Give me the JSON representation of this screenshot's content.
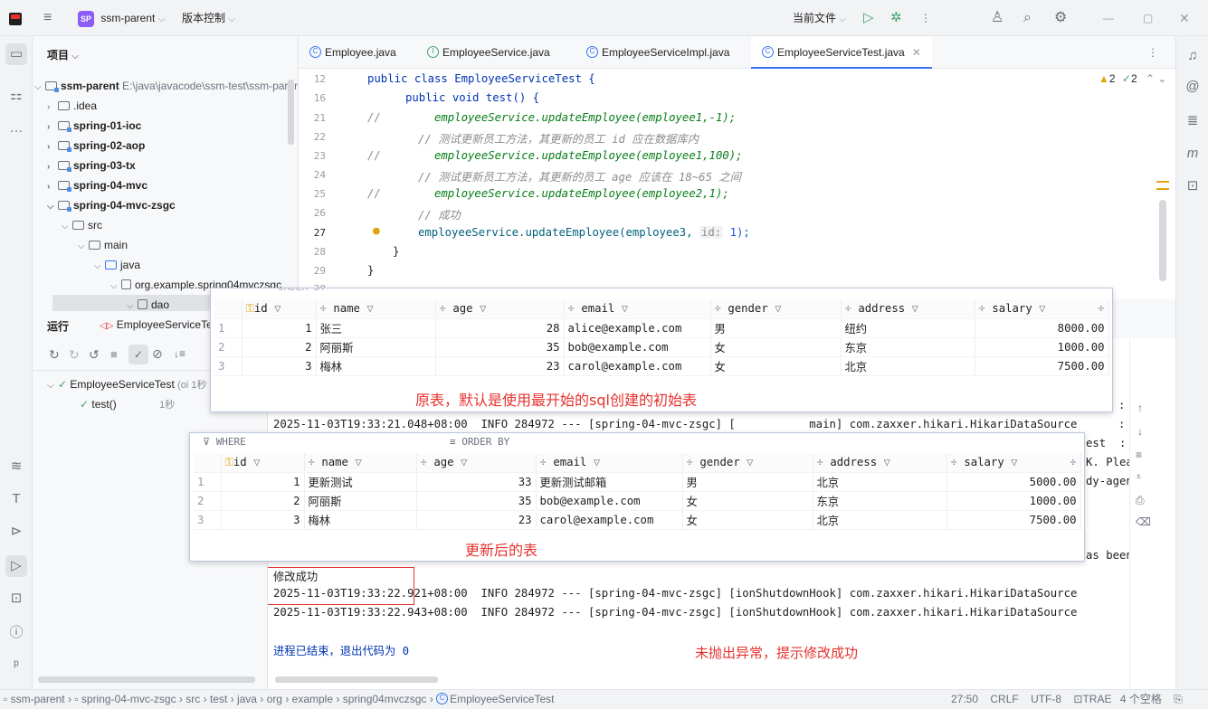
{
  "titlebar": {
    "project": "ssm-parent",
    "project_badge": "SP",
    "vcs": "版本控制",
    "current_file": "当前文件"
  },
  "project_panel": {
    "title": "项目",
    "items": [
      {
        "label": "ssm-parent",
        "path": "E:\\java\\javacode\\ssm-test\\ssm-parent"
      },
      {
        "label": ".idea"
      },
      {
        "label": "spring-01-ioc"
      },
      {
        "label": "spring-02-aop"
      },
      {
        "label": "spring-03-tx"
      },
      {
        "label": "spring-04-mvc"
      },
      {
        "label": "spring-04-mvc-zsgc"
      },
      {
        "label": "src"
      },
      {
        "label": "main"
      },
      {
        "label": "java"
      },
      {
        "label": "org.example.spring04mvczsgc"
      },
      {
        "label": "dao"
      }
    ]
  },
  "tabs": [
    {
      "label": "Employee.java"
    },
    {
      "label": "EmployeeService.java"
    },
    {
      "label": "EmployeeServiceImpl.java"
    },
    {
      "label": "EmployeeServiceTest.java",
      "active": true
    }
  ],
  "editor": {
    "warnings": "2",
    "checks": "2",
    "lines": [
      {
        "n": "12",
        "text": "public class EmployeeServiceTest {"
      },
      {
        "n": "16",
        "text": "public void test() {"
      },
      {
        "n": "21",
        "text": "employeeService.updateEmployee(employee1,-1);"
      },
      {
        "n": "22",
        "text": "// 测试更新员工方法，其更新的员工 id 应在数据库内"
      },
      {
        "n": "23",
        "text": "employeeService.updateEmployee(employee1,100);"
      },
      {
        "n": "24",
        "text": "// 测试更新员工方法，其更新的员工 age 应该在 18~65 之间"
      },
      {
        "n": "25",
        "text": "employeeService.updateEmployee(employee2,1);"
      },
      {
        "n": "26",
        "text": "// 成功"
      },
      {
        "n": "27",
        "text": "employeeService.updateEmployee(employee3,",
        "hint": "id:",
        "arg": "1);"
      },
      {
        "n": "28",
        "text": "}"
      },
      {
        "n": "29",
        "text": "}"
      },
      {
        "n": "30",
        "text": ""
      }
    ]
  },
  "run_panel": {
    "title": "运行",
    "config": "EmployeeServiceTest",
    "tree": [
      {
        "label": "EmployeeServiceTest",
        "meta": "(oi 1秒"
      },
      {
        "label": "test()",
        "meta": "1秒"
      }
    ]
  },
  "console": {
    "lines": [
      "2025-11-03T19:33:21.048+08:00  INFO 284972 --- [spring-04-mvc-zsgc] [           main] com.zaxxer.hikari.HikariDataSource",
      "修改成功",
      "2025-11-03T19:33:22.921+08:00  INFO 284972 --- [spring-04-mvc-zsgc] [ionShutdownHook] com.zaxxer.hikari.HikariDataSource",
      "2025-11-03T19:33:22.943+08:00  INFO 284972 --- [spring-04-mvc-zsgc] [ionShutdownHook] com.zaxxer.hikari.HikariDataSource",
      "进程已结束，退出代码为 0"
    ],
    "right_frag": [
      ": I",
      ": I",
      "est  : S",
      "K. Pleas",
      "dy-agent",
      "as been"
    ],
    "annotation": "未抛出异常，提示修改成功"
  },
  "table_original": {
    "columns": [
      "id",
      "name",
      "age",
      "email",
      "gender",
      "address",
      "salary"
    ],
    "rows": [
      [
        "1",
        "张三",
        "28",
        "alice@example.com",
        "男",
        "纽约",
        "8000.00"
      ],
      [
        "2",
        "阿丽斯",
        "35",
        "bob@example.com",
        "女",
        "东京",
        "1000.00"
      ],
      [
        "3",
        "梅林",
        "23",
        "carol@example.com",
        "女",
        "北京",
        "7500.00"
      ]
    ],
    "caption": "原表，默认是使用最开始的sql创建的初始表"
  },
  "table_updated": {
    "where": "WHERE",
    "order_by": "ORDER BY",
    "columns": [
      "id",
      "name",
      "age",
      "email",
      "gender",
      "address",
      "salary"
    ],
    "rows": [
      [
        "1",
        "更新测试",
        "33",
        "更新测试邮箱",
        "男",
        "北京",
        "5000.00"
      ],
      [
        "2",
        "阿丽斯",
        "35",
        "bob@example.com",
        "女",
        "东京",
        "1000.00"
      ],
      [
        "3",
        "梅林",
        "23",
        "carol@example.com",
        "女",
        "北京",
        "7500.00"
      ]
    ],
    "caption": "更新后的表"
  },
  "statusbar": {
    "breadcrumbs": [
      "ssm-parent",
      "spring-04-mvc-zsgc",
      "src",
      "test",
      "java",
      "org",
      "example",
      "spring04mvczsgc",
      "EmployeeServiceTest"
    ],
    "position": "27:50",
    "line_sep": "CRLF",
    "encoding": "UTF-8",
    "plugin": "TRAE",
    "indent": "4 个空格"
  },
  "colors": {
    "accent": "#3574f0",
    "annotation": "#e5322d"
  }
}
